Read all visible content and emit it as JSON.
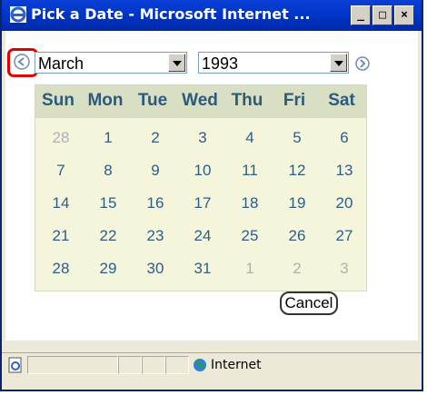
{
  "window": {
    "title": "Pick a Date - Microsoft Internet ..."
  },
  "picker": {
    "month": "March",
    "year": "1993",
    "weekdays": [
      "Sun",
      "Mon",
      "Tue",
      "Wed",
      "Thu",
      "Fri",
      "Sat"
    ],
    "weeks": [
      [
        "28",
        "1",
        "2",
        "3",
        "4",
        "5",
        "6"
      ],
      [
        "7",
        "8",
        "9",
        "10",
        "11",
        "12",
        "13"
      ],
      [
        "14",
        "15",
        "16",
        "17",
        "18",
        "19",
        "20"
      ],
      [
        "21",
        "22",
        "23",
        "24",
        "25",
        "26",
        "27"
      ],
      [
        "28",
        "29",
        "30",
        "31",
        "1",
        "2",
        "3"
      ]
    ],
    "cancel_label": "Cancel"
  },
  "status": {
    "zone": "Internet"
  },
  "colors": {
    "highlight": "#e00000",
    "calendar_bg": "#f5f5dc",
    "header_bg": "#d9dfc2",
    "day_text": "#2e5d86"
  }
}
